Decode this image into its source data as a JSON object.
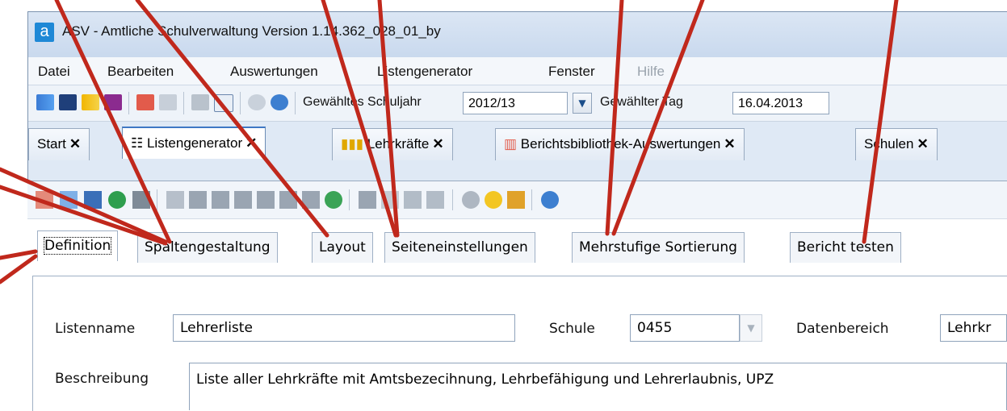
{
  "window": {
    "app_icon": "a",
    "title_prefix": "ASV - Amtliche Schulverwaltung Version 1.14.362_028_01_by"
  },
  "menu": [
    "Datei",
    "Bearbeiten",
    "Auswertungen",
    "Listengenerator",
    "Fenster",
    "Hilfe"
  ],
  "toolbar": {
    "schuljahr_label": "Gewähltes Schuljahr",
    "schuljahr_value": "2012/13",
    "tag_label": "Gewählter Tag",
    "tag_value": "16.04.2013"
  },
  "doc_tabs": [
    {
      "label": "Start"
    },
    {
      "label": "Listengenerator"
    },
    {
      "label": "Lehrkräfte"
    },
    {
      "label": "Berichtsbibliothek-Auswertungen"
    },
    {
      "label": "Schulen"
    }
  ],
  "close_glyph": "✕",
  "sub_tabs": [
    "Definition",
    "Spaltengestaltung",
    "Layout",
    "Seiteneinstellungen",
    "Mehrstufige Sortierung",
    "Bericht testen"
  ],
  "form": {
    "listenname_label": "Listenname",
    "listenname_value": "Lehrerliste",
    "schule_label": "Schule",
    "schule_value": "0455",
    "datenbereich_label": "Datenbereich",
    "datenbereich_value": "Lehrkr",
    "beschreibung_label": "Beschreibung",
    "beschreibung_value": "Liste aller Lehrkräfte mit Amtsbezecihnung, Lehrbefähigung und Lehrerlaubnis, UPZ"
  },
  "colors": {
    "annotation_arrow": "#c0281c",
    "accent_blue": "#1e88d6"
  }
}
